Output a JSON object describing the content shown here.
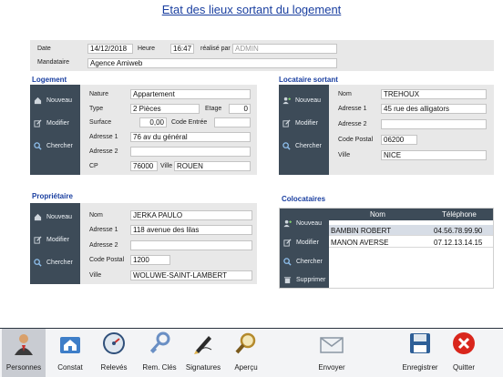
{
  "title": "Etat des lieux sortant du logement",
  "header": {
    "date_label": "Date",
    "date_value": "14/12/2018",
    "heure_label": "Heure",
    "heure_value": "16:47",
    "realise_label": "réalisé par",
    "realise_placeholder": "ADMIN",
    "mandataire_label": "Mandataire",
    "mandataire_value": "Agence Amiweb"
  },
  "logement": {
    "section_title": "Logement",
    "buttons": [
      "Nouveau",
      "Modifier",
      "Chercher"
    ],
    "nature_label": "Nature",
    "nature_value": "Appartement",
    "type_label": "Type",
    "type_value": "2 Pièces",
    "etage_label": "Etage",
    "etage_value": "0",
    "surface_label": "Surface",
    "surface_value": "0,00",
    "code_entree_label": "Code Entrée",
    "code_entree_value": "",
    "adresse1_label": "Adresse 1",
    "adresse1_value": "76 av du général",
    "adresse2_label": "Adresse 2",
    "adresse2_value": "",
    "cp_label": "CP",
    "cp_value": "76000",
    "ville_label": "Ville",
    "ville_value": "ROUEN"
  },
  "locataire": {
    "section_title": "Locataire sortant",
    "buttons": [
      "Nouveau",
      "Modifier",
      "Chercher"
    ],
    "nom_label": "Nom",
    "nom_value": "TREHOUX",
    "adresse1_label": "Adresse 1",
    "adresse1_value": "45 rue des alligators",
    "adresse2_label": "Adresse 2",
    "adresse2_value": "",
    "cp_label": "Code Postal",
    "cp_value": "06200",
    "ville_label": "Ville",
    "ville_value": "NICE"
  },
  "proprietaire": {
    "section_title": "Propriétaire",
    "buttons": [
      "Nouveau",
      "Modifier",
      "Chercher"
    ],
    "nom_label": "Nom",
    "nom_value": "JERKA PAULO",
    "adresse1_label": "Adresse 1",
    "adresse1_value": "118 avenue des lilas",
    "adresse2_label": "Adresse 2",
    "adresse2_value": "",
    "cp_label": "Code Postal",
    "cp_value": "1200",
    "ville_label": "Ville",
    "ville_value": "WOLUWE-SAINT-LAMBERT"
  },
  "colocataires": {
    "section_title": "Colocataires",
    "buttons": [
      "Nouveau",
      "Modifier",
      "Chercher",
      "Supprimer"
    ],
    "columns": [
      "Nom",
      "Téléphone"
    ],
    "rows": [
      {
        "nom": "BAMBIN ROBERT",
        "tel": "04.56.78.99.90"
      },
      {
        "nom": "MANON AVERSE",
        "tel": "07.12.13.14.15"
      }
    ]
  },
  "toolbar": {
    "items": [
      "Personnes",
      "Constat",
      "Relevés",
      "Rem. Clés",
      "Signatures",
      "Aperçu",
      "Envoyer",
      "Enregistrer",
      "Quitter"
    ],
    "active": "Personnes",
    "icons": [
      "person-icon",
      "house-icon",
      "meter-icon",
      "key-icon",
      "pen-icon",
      "magnifier-icon",
      "envelope-icon",
      "save-icon",
      "close-icon"
    ]
  },
  "colors": {
    "accent": "#1a3fa0",
    "side_panel": "#3d4b58",
    "panel_bg": "#e8e8e8",
    "selected_row": "#d7dde6",
    "quit_red": "#d9261c"
  }
}
